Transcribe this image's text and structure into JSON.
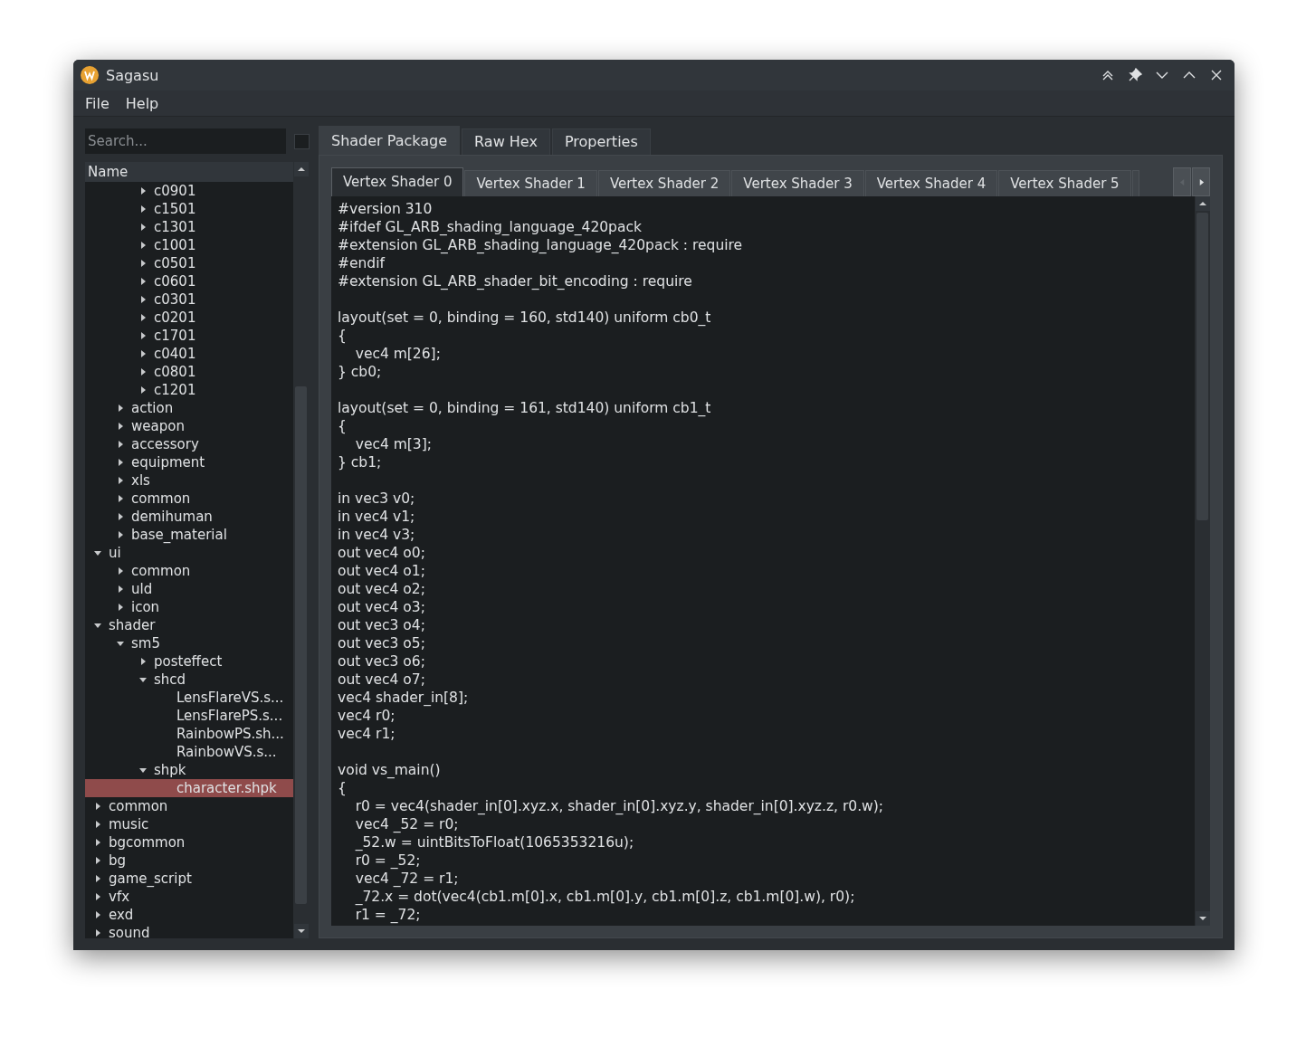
{
  "window": {
    "title": "Sagasu"
  },
  "menu": [
    "File",
    "Help"
  ],
  "search": {
    "placeholder": "Search..."
  },
  "filter_checkbox": {
    "checked": false
  },
  "tree": {
    "header": "Name",
    "items": [
      {
        "children": [
          {
            "children": [
              {
                "label": "c0901",
                "expanded": false,
                "selected": false
              },
              {
                "label": "c1501",
                "expanded": false,
                "selected": false
              },
              {
                "label": "c1301",
                "expanded": false,
                "selected": false
              },
              {
                "label": "c1001",
                "expanded": false,
                "selected": false
              },
              {
                "label": "c0501",
                "expanded": false,
                "selected": false
              },
              {
                "label": "c0601",
                "expanded": false,
                "selected": false
              },
              {
                "label": "c0301",
                "expanded": false,
                "selected": false
              },
              {
                "label": "c0201",
                "expanded": false,
                "selected": false
              },
              {
                "label": "c1701",
                "expanded": false,
                "selected": false
              },
              {
                "label": "c0401",
                "expanded": false,
                "selected": false
              },
              {
                "label": "c0801",
                "expanded": false,
                "selected": false
              },
              {
                "label": "c1201",
                "expanded": false,
                "selected": false
              }
            ]
          },
          {
            "label": "action",
            "expanded": false,
            "selected": false
          },
          {
            "label": "weapon",
            "expanded": false,
            "selected": false
          },
          {
            "label": "accessory",
            "expanded": false,
            "selected": false
          },
          {
            "label": "equipment",
            "expanded": false,
            "selected": false
          },
          {
            "label": "xls",
            "expanded": false,
            "selected": false
          },
          {
            "label": "common",
            "expanded": false,
            "selected": false
          },
          {
            "label": "demihuman",
            "expanded": false,
            "selected": false
          },
          {
            "label": "base_material",
            "expanded": false,
            "selected": false
          }
        ]
      },
      {
        "label": "ui",
        "expanded": true,
        "selected": false,
        "children": [
          {
            "label": "common",
            "expanded": false,
            "selected": false
          },
          {
            "label": "uld",
            "expanded": false,
            "selected": false
          },
          {
            "label": "icon",
            "expanded": false,
            "selected": false
          }
        ]
      },
      {
        "label": "shader",
        "expanded": true,
        "selected": false,
        "children": [
          {
            "label": "sm5",
            "expanded": true,
            "selected": false,
            "children": [
              {
                "label": "posteffect",
                "expanded": false,
                "selected": false
              },
              {
                "label": "shcd",
                "expanded": true,
                "selected": false,
                "children": [
                  {
                    "label": "LensFlareVS.s...",
                    "selected": false
                  },
                  {
                    "label": "LensFlarePS.s...",
                    "selected": false
                  },
                  {
                    "label": "RainbowPS.sh...",
                    "selected": false
                  },
                  {
                    "label": "RainbowVS.s...",
                    "selected": false
                  }
                ]
              },
              {
                "label": "shpk",
                "expanded": true,
                "selected": false,
                "children": [
                  {
                    "label": "character.shpk",
                    "selected": true
                  }
                ]
              }
            ]
          }
        ]
      },
      {
        "label": "common",
        "expanded": false,
        "selected": false
      },
      {
        "label": "music",
        "expanded": false,
        "selected": false
      },
      {
        "label": "bgcommon",
        "expanded": false,
        "selected": false
      },
      {
        "label": "bg",
        "expanded": false,
        "selected": false
      },
      {
        "label": "game_script",
        "expanded": false,
        "selected": false
      },
      {
        "label": "vfx",
        "expanded": false,
        "selected": false
      },
      {
        "label": "exd",
        "expanded": false,
        "selected": false
      },
      {
        "label": "sound",
        "expanded": false,
        "selected": false
      }
    ]
  },
  "tabs": [
    {
      "label": "Shader Package",
      "selected": true
    },
    {
      "label": "Raw Hex",
      "selected": false
    },
    {
      "label": "Properties",
      "selected": false
    }
  ],
  "shader_tabs": [
    {
      "label": "Vertex Shader 0",
      "selected": true
    },
    {
      "label": "Vertex Shader 1",
      "selected": false
    },
    {
      "label": "Vertex Shader 2",
      "selected": false
    },
    {
      "label": "Vertex Shader 3",
      "selected": false
    },
    {
      "label": "Vertex Shader 4",
      "selected": false
    },
    {
      "label": "Vertex Shader 5",
      "selected": false
    }
  ],
  "code_blocks": [
    [
      "#version 310",
      "#ifdef GL_ARB_shading_language_420pack",
      "#extension GL_ARB_shading_language_420pack : require",
      "#endif",
      "#extension GL_ARB_shader_bit_encoding : require"
    ],
    [
      "layout(set = 0, binding = 160, std140) uniform cb0_t",
      "{",
      "    vec4 m[26];",
      "} cb0;"
    ],
    [
      "layout(set = 0, binding = 161, std140) uniform cb1_t",
      "{",
      "    vec4 m[3];",
      "} cb1;"
    ],
    [
      "in vec3 v0;",
      "in vec4 v1;",
      "in vec4 v3;",
      "out vec4 o0;",
      "out vec4 o1;",
      "out vec4 o2;",
      "out vec4 o3;",
      "out vec3 o4;",
      "out vec3 o5;",
      "out vec3 o6;",
      "out vec4 o7;",
      "vec4 shader_in[8];",
      "vec4 r0;",
      "vec4 r1;"
    ],
    [
      "void vs_main()",
      "{",
      "    r0 = vec4(shader_in[0].xyz.x, shader_in[0].xyz.y, shader_in[0].xyz.z, r0.w);",
      "    vec4 _52 = r0;",
      "    _52.w = uintBitsToFloat(1065353216u);",
      "    r0 = _52;",
      "    vec4 _72 = r1;",
      "    _72.x = dot(vec4(cb1.m[0].x, cb1.m[0].y, cb1.m[0].z, cb1.m[0].w), r0);",
      "    r1 = _72;"
    ]
  ]
}
